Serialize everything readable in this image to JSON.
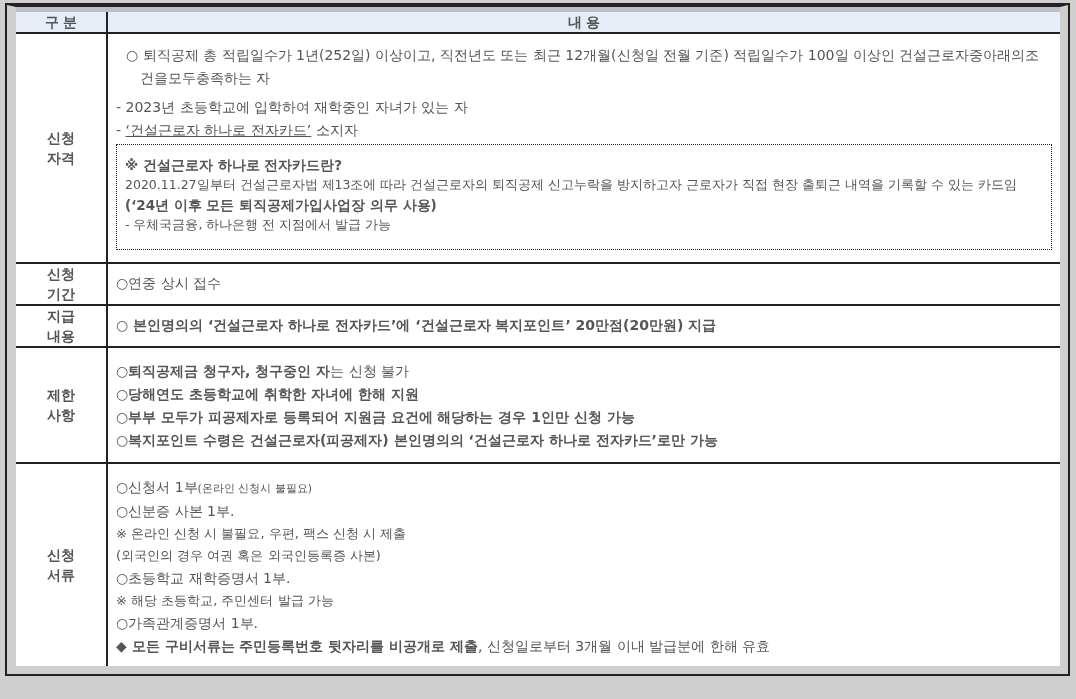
{
  "table": {
    "columns": [
      "구 분",
      "내 용"
    ],
    "rows": [
      {
        "label": "신청\n자격",
        "lines": [
          {
            "kind": "hanging",
            "text": "○ 퇴직공제 총 적립일수가 1년(252일) 이상이고, 직전년도 또는 최근 12개월(신청일 전월 기준) 적립일수가 100일 이상인 건설근로자중아래의조건을모두충족하는 자"
          },
          {
            "kind": "plain",
            "text": "- 2023년 초등학교에 입학하여 재학중인 자녀가 있는 자"
          },
          {
            "kind": "underlined",
            "before": "- ",
            "link": "‘건설근로자 하나로 전자카드’",
            "after": " 소지자"
          },
          {
            "kind": "box",
            "lines": [
              {
                "kind": "bold",
                "text": "※ 건설근로자 하나로 전자카드란?"
              },
              {
                "kind": "small",
                "text": "2020.11.27일부터 건설근로자법 제13조에 따라 건설근로자의 퇴직공제 신고누락을 방지하고자 근로자가 직접 현장 출퇴근 내역을 기록할 수 있는 카드임"
              },
              {
                "kind": "bold",
                "text": "(‘24년 이후 모든 퇴직공제가입사업장 의무 사용)"
              },
              {
                "kind": "small",
                "text": "- 우체국금융, 하나은행 전 지점에서 발급 가능"
              }
            ]
          }
        ]
      },
      {
        "label": "신청\n기간",
        "lines": [
          {
            "kind": "plain",
            "text": "○연중 상시 접수"
          }
        ]
      },
      {
        "label": "지급\n내용",
        "lines": [
          {
            "kind": "bold",
            "text": "○ 본인명의의 ‘건설근로자 하나로 전자카드’에 ‘건설근로자 복지포인트’ 20만점(20만원) 지급"
          }
        ]
      },
      {
        "label": "제한\n사항",
        "lines": [
          {
            "kind": "plain",
            "text": "**○퇴직공제금 청구자, 청구중인 자**는 신청 불가"
          },
          {
            "kind": "bold",
            "text": "○당해연도 초등학교에 취학한 자녀에 한해 지원"
          },
          {
            "kind": "bold",
            "text": "○부부 모두가 피공제자로 등록되어 지원금 요건에 해당하는 경우 1인만 신청 가능"
          },
          {
            "kind": "bold",
            "text": "○복지포인트 수령은 건설근로자(피공제자) 본인명의의 ‘건설근로자 하나로 전자카드’로만 가능"
          }
        ]
      },
      {
        "label": "신청\n서류",
        "lines": [
          {
            "kind": "plain",
            "text": "○신청서 1부",
            "small": "(온라인 신청시 불필요)"
          },
          {
            "kind": "plain",
            "text": "○신분증 사본 1부."
          },
          {
            "kind": "note",
            "text": "※ 온라인 신청 시 불필요, 우편, 팩스 신청 시 제출"
          },
          {
            "kind": "note",
            "text": "(외국인의 경우 여권 혹은 외국인등록증 사본)"
          },
          {
            "kind": "plain",
            "text": "○초등학교 재학증명서 1부."
          },
          {
            "kind": "note",
            "text": "※ 해당 초등학교, 주민센터 발급 가능"
          },
          {
            "kind": "plain",
            "text": "○가족관계증명서 1부."
          },
          {
            "kind": "plain",
            "text": "**◆ 모든 구비서류는 주민등록번호 뒷자리를 비공개로 제출**, 신청일로부터 3개월 이내 발급분에 한해 유효"
          }
        ]
      }
    ]
  }
}
